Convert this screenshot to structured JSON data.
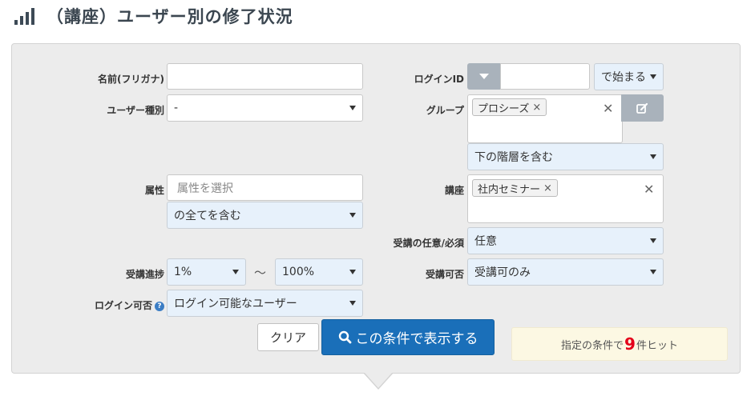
{
  "page": {
    "title": "（講座）ユーザー別の修了状況",
    "icon": "signal-bars-icon"
  },
  "form": {
    "name": {
      "label": "名前(フリガナ)",
      "value": ""
    },
    "user_type": {
      "label": "ユーザー種別",
      "value": "-"
    },
    "attribute": {
      "label": "属性",
      "placeholder": "属性を選択",
      "match": "の全てを含む"
    },
    "progress": {
      "label": "受講進捗",
      "from": "1%",
      "separator": "～",
      "to": "100%"
    },
    "login_allowed": {
      "label": "ログイン可否",
      "help_icon": "question-circle-icon",
      "value": "ログイン可能なユーザー"
    },
    "login_id": {
      "label": "ログインID",
      "value": "",
      "match": "で始まる"
    },
    "group": {
      "label": "グループ",
      "tags": [
        "プロシーズ"
      ],
      "hierarchy": "下の階層を含む",
      "edit_icon": "edit-icon"
    },
    "course": {
      "label": "講座",
      "tags": [
        "社内セミナー"
      ]
    },
    "required": {
      "label": "受講の任意/必須",
      "value": "任意"
    },
    "course_allowed": {
      "label": "受講可否",
      "value": "受講可のみ"
    }
  },
  "buttons": {
    "clear": "クリア",
    "search": "この条件で表示する",
    "search_icon": "search-icon"
  },
  "hits": {
    "prefix": "指定の条件で",
    "count": "9",
    "suffix": "件ヒット"
  },
  "colors": {
    "primary": "#1a6fb9",
    "hit_count": "#e4001b",
    "panel": "#ececec",
    "select_bg": "#e7f1fb"
  }
}
